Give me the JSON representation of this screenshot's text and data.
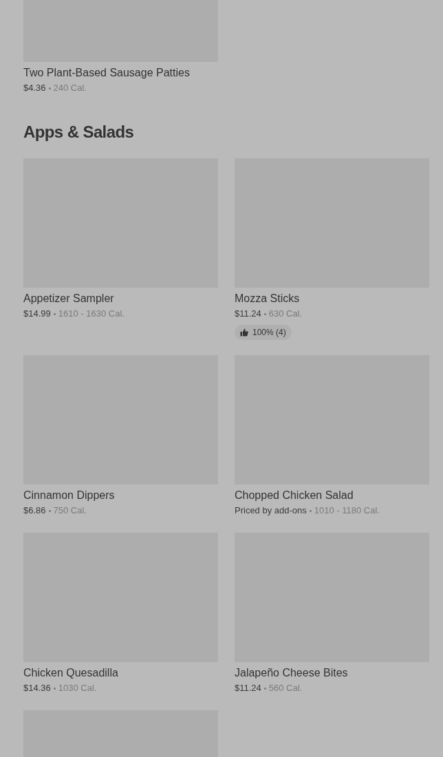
{
  "top_items": [
    {
      "name": "Two Plant-Based Sausage Patties",
      "price": "$4.36",
      "calories": "240 Cal."
    }
  ],
  "sections": [
    {
      "title": "Apps & Salads",
      "items": [
        {
          "name": "Appetizer Sampler",
          "price": "$14.99",
          "calories": "1610 - 1630 Cal."
        },
        {
          "name": "Mozza Sticks",
          "price": "$11.24",
          "calories": "630 Cal.",
          "rating": "100% (4)"
        },
        {
          "name": "Cinnamon Dippers",
          "price": "$6.86",
          "calories": "750 Cal."
        },
        {
          "name": "Chopped Chicken Salad",
          "price": "Priced by add-ons",
          "calories": "1010 - 1180 Cal."
        },
        {
          "name": "Chicken Quesadilla",
          "price": "$14.36",
          "calories": "1030 Cal."
        },
        {
          "name": "Jalapeño Cheese Bites",
          "price": "$11.24",
          "calories": "560 Cal."
        }
      ],
      "cut_off_card": true
    }
  ]
}
